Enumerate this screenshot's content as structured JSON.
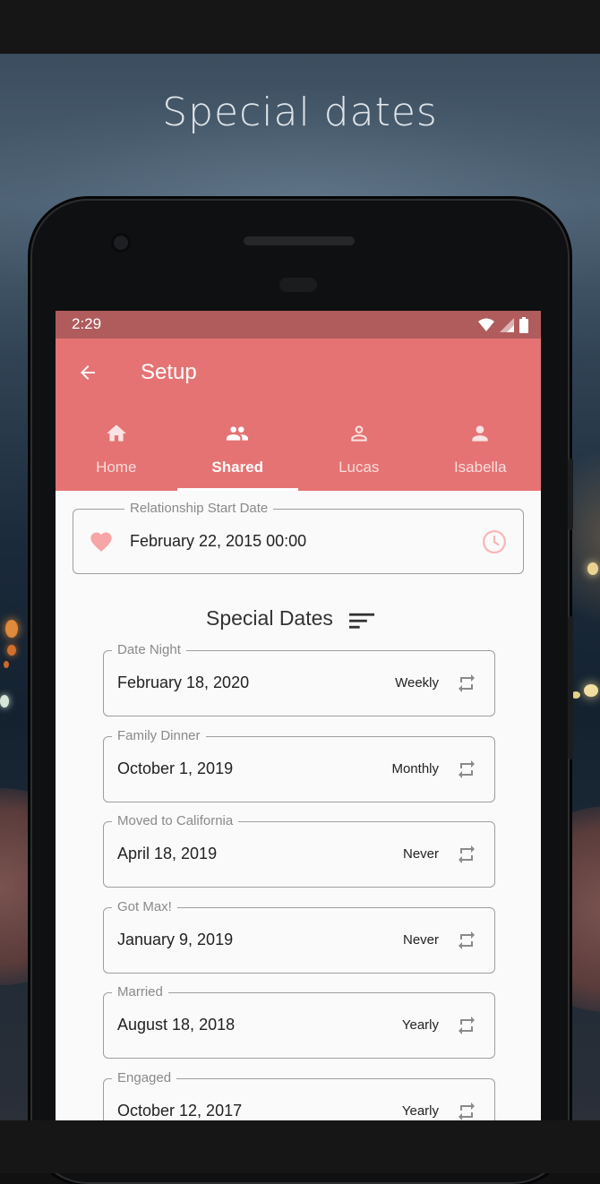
{
  "headline": "Special dates",
  "status_bar": {
    "time": "2:29"
  },
  "app_bar": {
    "title": "Setup"
  },
  "tabs": [
    {
      "label": "Home",
      "icon": "home-icon",
      "active": false
    },
    {
      "label": "Shared",
      "icon": "people-icon",
      "active": true
    },
    {
      "label": "Lucas",
      "icon": "person-outline-icon",
      "active": false
    },
    {
      "label": "Isabella",
      "icon": "person-icon",
      "active": false
    }
  ],
  "relationship": {
    "legend": "Relationship Start Date",
    "value": "February 22, 2015 00:00"
  },
  "special_dates": {
    "title": "Special Dates",
    "items": [
      {
        "name": "Date Night",
        "date": "February 18, 2020",
        "repeat": "Weekly"
      },
      {
        "name": "Family Dinner",
        "date": "October 1, 2019",
        "repeat": "Monthly"
      },
      {
        "name": "Moved to California",
        "date": "April 18, 2019",
        "repeat": "Never"
      },
      {
        "name": "Got Max!",
        "date": "January 9, 2019",
        "repeat": "Never"
      },
      {
        "name": "Married",
        "date": "August 18, 2018",
        "repeat": "Yearly"
      },
      {
        "name": "Engaged",
        "date": "October 12, 2017",
        "repeat": "Yearly"
      }
    ]
  },
  "colors": {
    "primary": "#e57373",
    "status_bar": "#b05c5c",
    "heart": "#f8a5a8"
  }
}
